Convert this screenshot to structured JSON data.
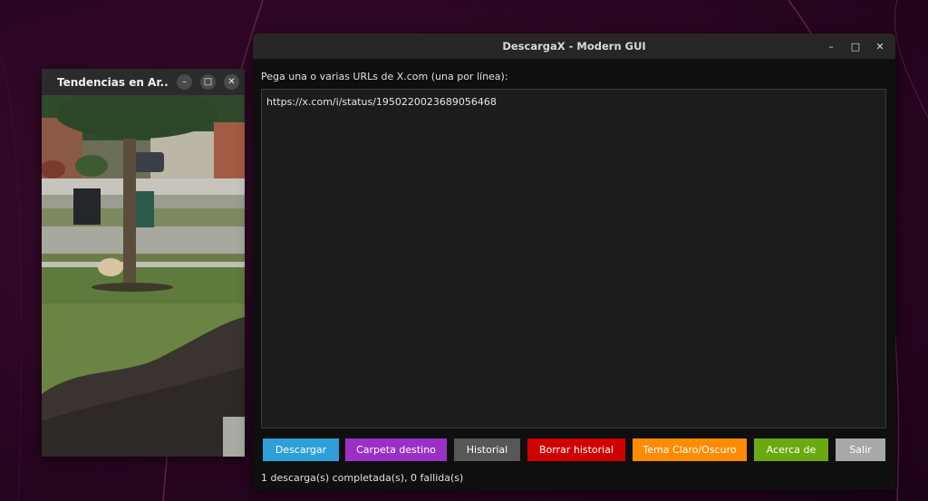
{
  "video_window": {
    "title": "Tendencias en Ar...",
    "icons": [
      "minimize-icon",
      "maximize-icon",
      "close-icon"
    ]
  },
  "main_window": {
    "title": "DescargaX - Modern GUI",
    "prompt_label": "Pega una o varias URLs de X.com (una por línea):",
    "url_text": "https://x.com/i/status/1950220023689056468",
    "buttons": {
      "descargar": {
        "label": "Descargar",
        "color": "#2e9fd8"
      },
      "carpeta": {
        "label": "Carpeta destino",
        "color": "#9b30c6"
      },
      "historial": {
        "label": "Historial",
        "color": "#575757"
      },
      "borrar": {
        "label": "Borrar historial",
        "color": "#d10000"
      },
      "tema": {
        "label": "Tema Claro/Oscuro",
        "color": "#ff8c00"
      },
      "acerca": {
        "label": "Acerca de",
        "color": "#6aaa10"
      },
      "salir": {
        "label": "Salir",
        "color": "#a8a8a8"
      }
    },
    "status": "1 descarga(s) completada(s), 0 fallida(s)"
  },
  "colors": {
    "desktop_bg": "#2a0622",
    "window_bg": "#0f0f0f",
    "titlebar_bg": "#262626",
    "textarea_bg": "#1c1c1c"
  }
}
